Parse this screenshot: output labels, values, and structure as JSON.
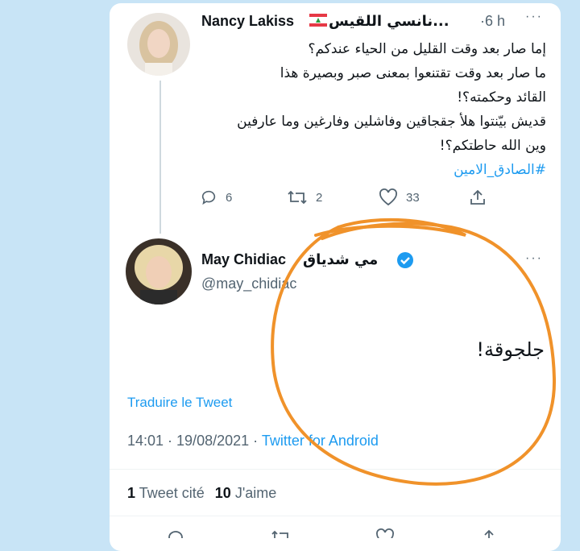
{
  "tweet1": {
    "author_name": "Nancy Lakiss",
    "author_name_ar": "...نانسي اللقيس",
    "time": "·6 h",
    "more": "···",
    "lines": [
      "إما صار بعد وقت القليل من الحياء عندكم؟",
      "ما صار بعد وقت تقتنعوا بمعنى صبر وبصيرة هذا",
      "القائد وحكمته؟!",
      "قديش بيّنتوا  هلأ جقجاقين وفاشلين وفارغين وما عارفين",
      "وين الله حاطتكم؟!"
    ],
    "hashtag": "#الصادق_الامين",
    "replies": "6",
    "retweets": "2",
    "likes": "33"
  },
  "tweet2": {
    "author_name": "May Chidiac",
    "author_name_ar": "مي شدياق",
    "handle": "@may_chidiac",
    "more": "···",
    "text": "جلجوقة!",
    "translate": "Traduire le Tweet",
    "timestamp": "14:01 · 19/08/2021 · ",
    "source": "Twitter for Android",
    "quote_count": "1",
    "quote_label": "Tweet cité",
    "like_count": "10",
    "like_label": "J'aime"
  },
  "colors": {
    "accent": "#1d9bf0",
    "annotation": "#f0922a",
    "background": "#c8e4f6"
  }
}
